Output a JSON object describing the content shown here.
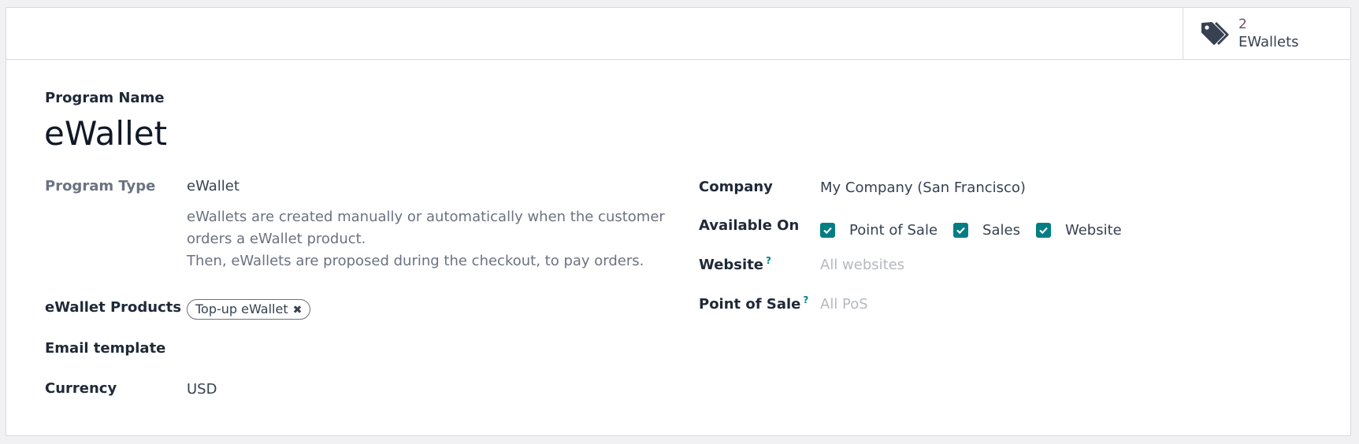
{
  "stat_button": {
    "icon": "tags-icon",
    "value": "2",
    "label": "EWallets"
  },
  "program_name": {
    "label": "Program Name",
    "value": "eWallet"
  },
  "left": {
    "program_type": {
      "label": "Program Type",
      "value": "eWallet",
      "description": [
        "eWallets are created manually or automatically when the customer",
        "orders a eWallet product.",
        "Then, eWallets are proposed during the checkout, to pay orders."
      ]
    },
    "products": {
      "label": "eWallet Products",
      "tags": [
        "Top-up eWallet"
      ]
    },
    "email_template": {
      "label": "Email template",
      "value": ""
    },
    "currency": {
      "label": "Currency",
      "value": "USD"
    }
  },
  "right": {
    "company": {
      "label": "Company",
      "value": "My Company (San Francisco)"
    },
    "available_on": {
      "label": "Available On",
      "options": [
        {
          "label": "Point of Sale",
          "checked": true
        },
        {
          "label": "Sales",
          "checked": true
        },
        {
          "label": "Website",
          "checked": true
        }
      ]
    },
    "website": {
      "label": "Website",
      "help": "?",
      "placeholder": "All websites"
    },
    "point_of_sale": {
      "label": "Point of Sale",
      "help": "?",
      "placeholder": "All PoS"
    }
  },
  "colors": {
    "accent": "#017e84",
    "brand": "#714b67"
  }
}
